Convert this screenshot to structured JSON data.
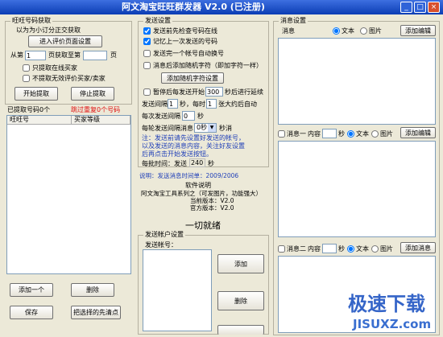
{
  "window": {
    "title": "阿文淘宝旺旺群发器 V2.0 (已注册)",
    "min": "_",
    "max": "□",
    "close": "×"
  },
  "grab": {
    "title": "旺旺号码获取",
    "hint": "以为为小订分正交获取",
    "enter_button": "进入评价页面设置",
    "from_label": "从第",
    "from_value": "1",
    "mid_label": "页获取至第",
    "to_value": "",
    "page_suffix": "页",
    "only_online": {
      "label": "只提取在线买家",
      "checked": false
    },
    "skip_invalid": {
      "label": "不提取无效评价买家/卖家",
      "checked": false
    },
    "start_button": "开始提取",
    "stop_button": "停止提取",
    "count_label": "已提取号码0个",
    "skip_label": "跳过重复0个号码",
    "columns": [
      "旺旺号",
      "买家等级"
    ],
    "add_button": "添加一个",
    "delete_button": "删除",
    "save_button": "保存",
    "clear_button": "把选择的先清点"
  },
  "send": {
    "title": "发送设置",
    "options": [
      {
        "label": "发送前先检查号码在线",
        "checked": true
      },
      {
        "label": "记忆上一次发送的号码",
        "checked": true
      },
      {
        "label": "发送完一个帐号自动换号",
        "checked": false
      },
      {
        "label": "消息后添加随机字符（即加字符一样）",
        "checked": false
      }
    ],
    "random_button": "添加随机字符设置",
    "pause": {
      "label": "暂停后每发送开始",
      "value": "300",
      "suffix": "秒后进行延续",
      "checked": false
    },
    "interval": {
      "label": "发送间隔",
      "value1": "1",
      "mid": "秒，每时",
      "value2": "1",
      "suffix": "张大约后自动"
    },
    "each_interval": {
      "label": "每次发送间隔",
      "value": "0",
      "suffix": "秒"
    },
    "round_wait": {
      "label": "每轮发送间隔消息",
      "value": "0秒",
      "suffix": "秒消"
    },
    "notes": [
      "注：发送前请先设置好发送的帐号，",
      "以及发送的消息内容，关注好友设置",
      "后再点击开始发送按钮。"
    ],
    "batch": {
      "label": "每批时间：发送",
      "value": "240",
      "suffix": "秒"
    }
  },
  "about": {
    "note": "说明：发送消息时间单：2009/2006",
    "heading": "软件说明",
    "series": "阿文淘宝工具系列之（可发图片，功能强大）",
    "current_version": "当前版本：V2.0",
    "official_version": "官方版本：V2.0"
  },
  "status": "一切就绪",
  "account": {
    "title": "发送帐户设置",
    "label": "发送帐号：",
    "add_button": "添加",
    "delete_button": "删除"
  },
  "message": {
    "title": "消息设置",
    "main_label": "消息",
    "text_option": "文本",
    "image_option": "图片",
    "main_button": "添加编辑",
    "msg1": {
      "label": "消息一",
      "delay_label": "内容",
      "delay_value": "",
      "unit": "秒",
      "checked": false,
      "button": "添加编辑"
    },
    "msg2": {
      "label": "消息二",
      "delay_label": "内容",
      "delay_value": "",
      "unit": "秒",
      "checked": false,
      "button": "添加消息"
    }
  },
  "watermark": {
    "cn": "极速下载",
    "en": "JISUXZ.com"
  },
  "colors": {
    "titlebar": "#0b3db4",
    "background": "#ece9d8",
    "note_blue": "#1f3fb8",
    "warn_red": "#e01010",
    "watermark": "#3565c8"
  }
}
